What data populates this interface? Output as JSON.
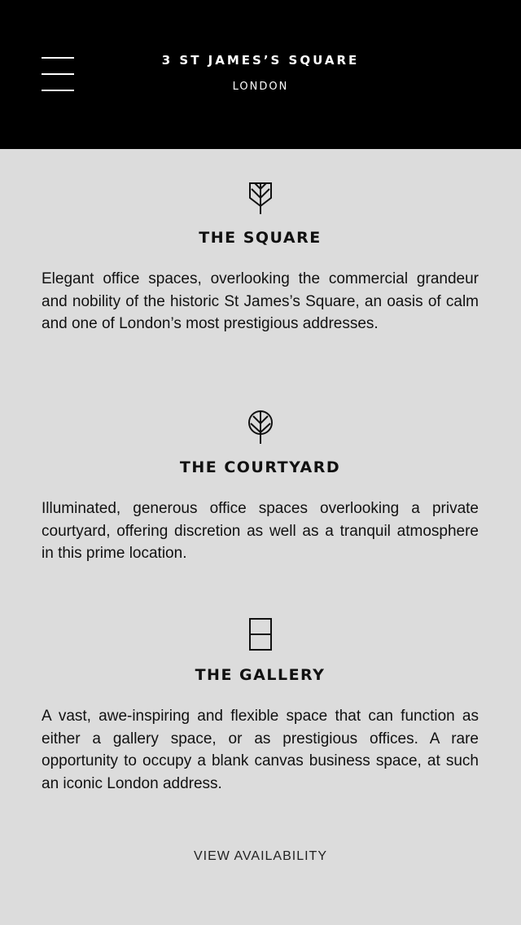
{
  "header": {
    "menu_icon": "hamburger-menu-icon",
    "title": "3 ST JAMES’S SQUARE",
    "subtitle": "LONDON"
  },
  "sections": [
    {
      "icon": "leaf-tree-icon",
      "title": "THE SQUARE",
      "body": "Elegant office spaces, overlooking the commercial grandeur and nobility of the historic St James’s Square, an oasis of calm and one of London’s most prestigious addresses."
    },
    {
      "icon": "round-tree-icon",
      "title": "THE COURTYARD",
      "body": "Illuminated, generous office spaces overlooking a private courtyard, offering discretion as well as a tranquil atmosphere in this prime location."
    },
    {
      "icon": "window-frame-icon",
      "title": "THE GALLERY",
      "body": "A vast, awe-inspiring and flexible space that can function as either a gallery space, or as prestigious offices. A rare opportunity to occupy a blank canvas business space, at such an iconic London address."
    }
  ],
  "cta": {
    "label": "VIEW AVAILABILITY"
  },
  "colors": {
    "header_bg": "#000000",
    "page_bg": "#dcdcdc",
    "text": "#111111"
  }
}
